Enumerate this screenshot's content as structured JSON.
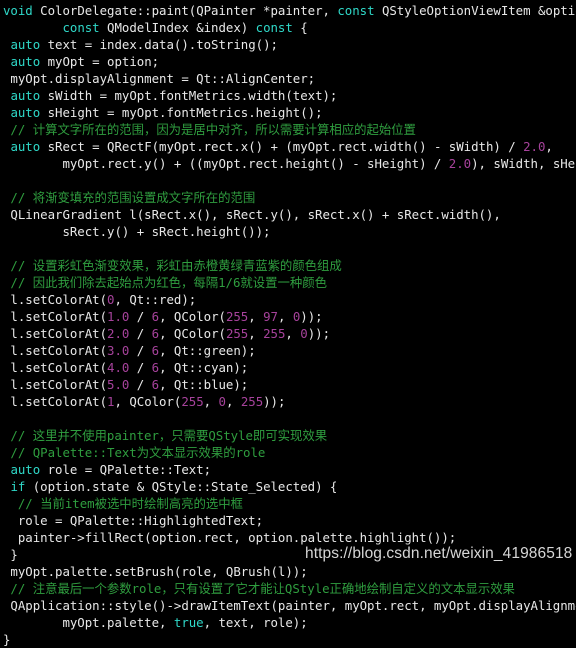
{
  "editor": {
    "background": "#000000",
    "foreground": "#e8e8e8",
    "keyword_color": "#2fd8c8",
    "number_color": "#a6429b",
    "comment_color": "#2f9e3f",
    "language": "cpp"
  },
  "watermark": {
    "text": "https://blog.csdn.net/weixin_41986518"
  },
  "lines": [
    [
      {
        "t": "void",
        "c": "kw"
      },
      {
        "t": " ColorDelegate::paint(QPainter *painter, ",
        "c": "plain"
      },
      {
        "t": "const",
        "c": "kw"
      },
      {
        "t": " QStyleOptionViewItem &option,",
        "c": "plain"
      }
    ],
    [
      {
        "t": "        ",
        "c": "plain"
      },
      {
        "t": "const",
        "c": "kw"
      },
      {
        "t": " QModelIndex &index) ",
        "c": "plain"
      },
      {
        "t": "const",
        "c": "kw"
      },
      {
        "t": " {",
        "c": "plain"
      }
    ],
    [
      {
        "t": " ",
        "c": "plain"
      },
      {
        "t": "auto",
        "c": "kw"
      },
      {
        "t": " text = index.data().toString();",
        "c": "plain"
      }
    ],
    [
      {
        "t": " ",
        "c": "plain"
      },
      {
        "t": "auto",
        "c": "kw"
      },
      {
        "t": " myOpt = option;",
        "c": "plain"
      }
    ],
    [
      {
        "t": " myOpt.displayAlignment = Qt::AlignCenter;",
        "c": "plain"
      }
    ],
    [
      {
        "t": " ",
        "c": "plain"
      },
      {
        "t": "auto",
        "c": "kw"
      },
      {
        "t": " sWidth = myOpt.fontMetrics.width(text);",
        "c": "plain"
      }
    ],
    [
      {
        "t": " ",
        "c": "plain"
      },
      {
        "t": "auto",
        "c": "kw"
      },
      {
        "t": " sHeight = myOpt.fontMetrics.height();",
        "c": "plain"
      }
    ],
    [
      {
        "t": " // 计算文字所在的范围，因为是居中对齐，所以需要计算相应的起始位置",
        "c": "comment"
      }
    ],
    [
      {
        "t": " ",
        "c": "plain"
      },
      {
        "t": "auto",
        "c": "kw"
      },
      {
        "t": " sRect = QRectF(myOpt.rect.x() + (myOpt.rect.width() - sWidth) / ",
        "c": "plain"
      },
      {
        "t": "2.0",
        "c": "num"
      },
      {
        "t": ",",
        "c": "plain"
      }
    ],
    [
      {
        "t": "        myOpt.rect.y() + ((myOpt.rect.height() - sHeight) / ",
        "c": "plain"
      },
      {
        "t": "2.0",
        "c": "num"
      },
      {
        "t": "), sWidth, sHeight);",
        "c": "plain"
      }
    ],
    [
      {
        "t": "",
        "c": "plain"
      }
    ],
    [
      {
        "t": " // 将渐变填充的范围设置成文字所在的范围",
        "c": "comment"
      }
    ],
    [
      {
        "t": " QLinearGradient l(sRect.x(), sRect.y(), sRect.x() + sRect.width(),",
        "c": "plain"
      }
    ],
    [
      {
        "t": "        sRect.y() + sRect.height());",
        "c": "plain"
      }
    ],
    [
      {
        "t": "",
        "c": "plain"
      }
    ],
    [
      {
        "t": " // 设置彩虹色渐变效果，彩虹由赤橙黄绿青蓝紫的颜色组成",
        "c": "comment"
      }
    ],
    [
      {
        "t": " // 因此我们除去起始点为红色，每隔1/6就设置一种颜色",
        "c": "comment"
      }
    ],
    [
      {
        "t": " l.setColorAt(",
        "c": "plain"
      },
      {
        "t": "0",
        "c": "num"
      },
      {
        "t": ", Qt::red);",
        "c": "plain"
      }
    ],
    [
      {
        "t": " l.setColorAt(",
        "c": "plain"
      },
      {
        "t": "1.0",
        "c": "num"
      },
      {
        "t": " / ",
        "c": "plain"
      },
      {
        "t": "6",
        "c": "num"
      },
      {
        "t": ", QColor(",
        "c": "plain"
      },
      {
        "t": "255",
        "c": "num"
      },
      {
        "t": ", ",
        "c": "plain"
      },
      {
        "t": "97",
        "c": "num"
      },
      {
        "t": ", ",
        "c": "plain"
      },
      {
        "t": "0",
        "c": "num"
      },
      {
        "t": "));",
        "c": "plain"
      }
    ],
    [
      {
        "t": " l.setColorAt(",
        "c": "plain"
      },
      {
        "t": "2.0",
        "c": "num"
      },
      {
        "t": " / ",
        "c": "plain"
      },
      {
        "t": "6",
        "c": "num"
      },
      {
        "t": ", QColor(",
        "c": "plain"
      },
      {
        "t": "255",
        "c": "num"
      },
      {
        "t": ", ",
        "c": "plain"
      },
      {
        "t": "255",
        "c": "num"
      },
      {
        "t": ", ",
        "c": "plain"
      },
      {
        "t": "0",
        "c": "num"
      },
      {
        "t": "));",
        "c": "plain"
      }
    ],
    [
      {
        "t": " l.setColorAt(",
        "c": "plain"
      },
      {
        "t": "3.0",
        "c": "num"
      },
      {
        "t": " / ",
        "c": "plain"
      },
      {
        "t": "6",
        "c": "num"
      },
      {
        "t": ", Qt::green);",
        "c": "plain"
      }
    ],
    [
      {
        "t": " l.setColorAt(",
        "c": "plain"
      },
      {
        "t": "4.0",
        "c": "num"
      },
      {
        "t": " / ",
        "c": "plain"
      },
      {
        "t": "6",
        "c": "num"
      },
      {
        "t": ", Qt::cyan);",
        "c": "plain"
      }
    ],
    [
      {
        "t": " l.setColorAt(",
        "c": "plain"
      },
      {
        "t": "5.0",
        "c": "num"
      },
      {
        "t": " / ",
        "c": "plain"
      },
      {
        "t": "6",
        "c": "num"
      },
      {
        "t": ", Qt::blue);",
        "c": "plain"
      }
    ],
    [
      {
        "t": " l.setColorAt(",
        "c": "plain"
      },
      {
        "t": "1",
        "c": "num"
      },
      {
        "t": ", QColor(",
        "c": "plain"
      },
      {
        "t": "255",
        "c": "num"
      },
      {
        "t": ", ",
        "c": "plain"
      },
      {
        "t": "0",
        "c": "num"
      },
      {
        "t": ", ",
        "c": "plain"
      },
      {
        "t": "255",
        "c": "num"
      },
      {
        "t": "));",
        "c": "plain"
      }
    ],
    [
      {
        "t": "",
        "c": "plain"
      }
    ],
    [
      {
        "t": " // 这里并不使用painter，只需要QStyle即可实现效果",
        "c": "comment"
      }
    ],
    [
      {
        "t": " // QPalette::Text为文本显示效果的role",
        "c": "comment"
      }
    ],
    [
      {
        "t": " ",
        "c": "plain"
      },
      {
        "t": "auto",
        "c": "kw"
      },
      {
        "t": " role = QPalette::Text;",
        "c": "plain"
      }
    ],
    [
      {
        "t": " ",
        "c": "plain"
      },
      {
        "t": "if",
        "c": "kw"
      },
      {
        "t": " (option.state & QStyle::State_Selected) {",
        "c": "plain"
      }
    ],
    [
      {
        "t": "  // 当前item被选中时绘制高亮的选中框",
        "c": "comment"
      }
    ],
    [
      {
        "t": "  role = QPalette::HighlightedText;",
        "c": "plain"
      }
    ],
    [
      {
        "t": "  painter->fillRect(option.rect, option.palette.highlight());",
        "c": "plain"
      }
    ],
    [
      {
        "t": " }",
        "c": "plain"
      }
    ],
    [
      {
        "t": " myOpt.palette.setBrush(role, QBrush(l));",
        "c": "plain"
      }
    ],
    [
      {
        "t": " // 注意最后一个参数role，只有设置了它才能让QStyle正确地绘制自定义的文本显示效果",
        "c": "comment"
      }
    ],
    [
      {
        "t": " QApplication::style()->drawItemText(painter, myOpt.rect, myOpt.displayAlignment,",
        "c": "plain"
      }
    ],
    [
      {
        "t": "        myOpt.palette, ",
        "c": "plain"
      },
      {
        "t": "true",
        "c": "kw"
      },
      {
        "t": ", text, role);",
        "c": "plain"
      }
    ],
    [
      {
        "t": "}",
        "c": "plain"
      }
    ]
  ]
}
